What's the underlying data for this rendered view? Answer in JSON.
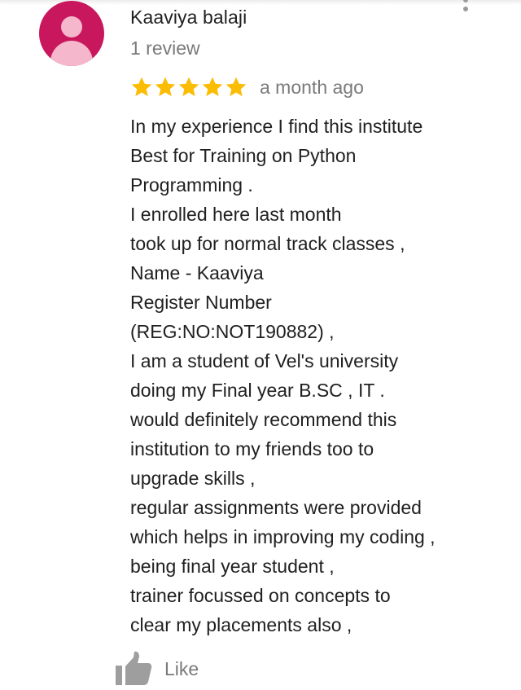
{
  "review": {
    "reviewer": {
      "name": "Kaaviya balaji",
      "review_count": "1 review",
      "avatar_icon": "person-icon",
      "avatar_color": "#c8175d"
    },
    "rating": {
      "stars": 5,
      "max_stars": 5,
      "star_color": "#fbbc04"
    },
    "date": "a month ago",
    "text_lines": [
      "In my experience I find this institute",
      "Best for Training on Python",
      "Programming .",
      "I enrolled here last month",
      "took up for normal track classes ,",
      "Name - Kaaviya",
      "Register Number",
      "(REG:NO:NOT190882) ,",
      "I am a student of Vel's university",
      "doing my Final year B.SC , IT .",
      "would definitely recommend this",
      "institution to my friends too to",
      "upgrade skills ,",
      "regular assignments were provided",
      "which helps in improving my coding ,",
      "being final year student ,",
      "trainer focussed on concepts to",
      "clear my placements also ,"
    ],
    "menu_icon": "more-vertical-icon",
    "like": {
      "label": "Like",
      "icon": "thumbs-up-icon"
    }
  }
}
